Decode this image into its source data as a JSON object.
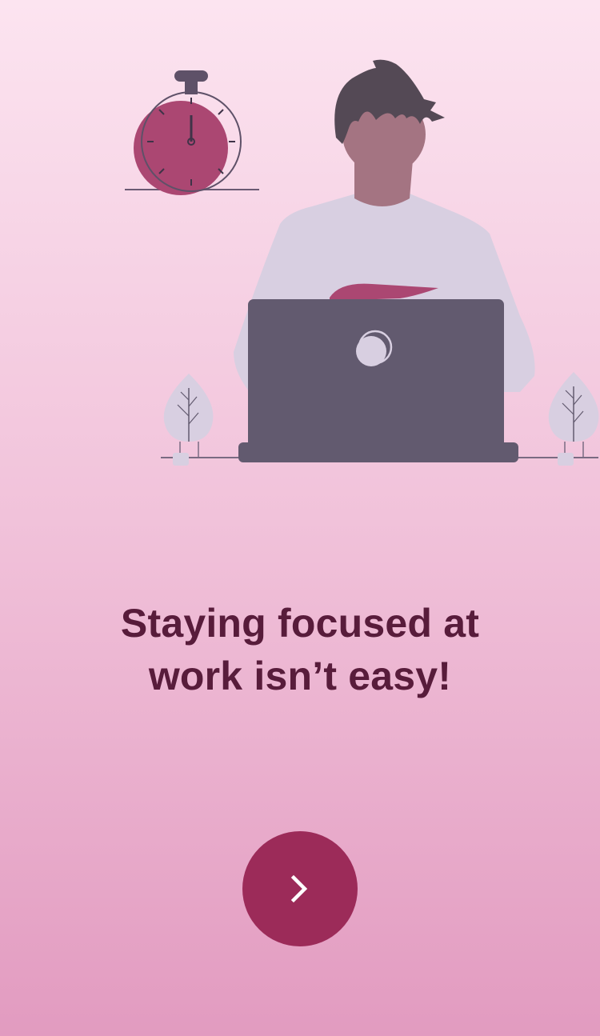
{
  "onboarding": {
    "headline_line1": "Staying focused at",
    "headline_line2": "work isn’t easy!",
    "next_icon": "chevron-right-icon"
  },
  "colors": {
    "background_top": "#fce4f0",
    "background_bottom": "#e29bc0",
    "headline": "#581c3b",
    "accent": "#9c2b59",
    "button_icon": "#ffffff"
  },
  "illustration": {
    "elements": [
      "stopwatch-icon",
      "person",
      "laptop",
      "plant-left",
      "plant-right"
    ]
  }
}
